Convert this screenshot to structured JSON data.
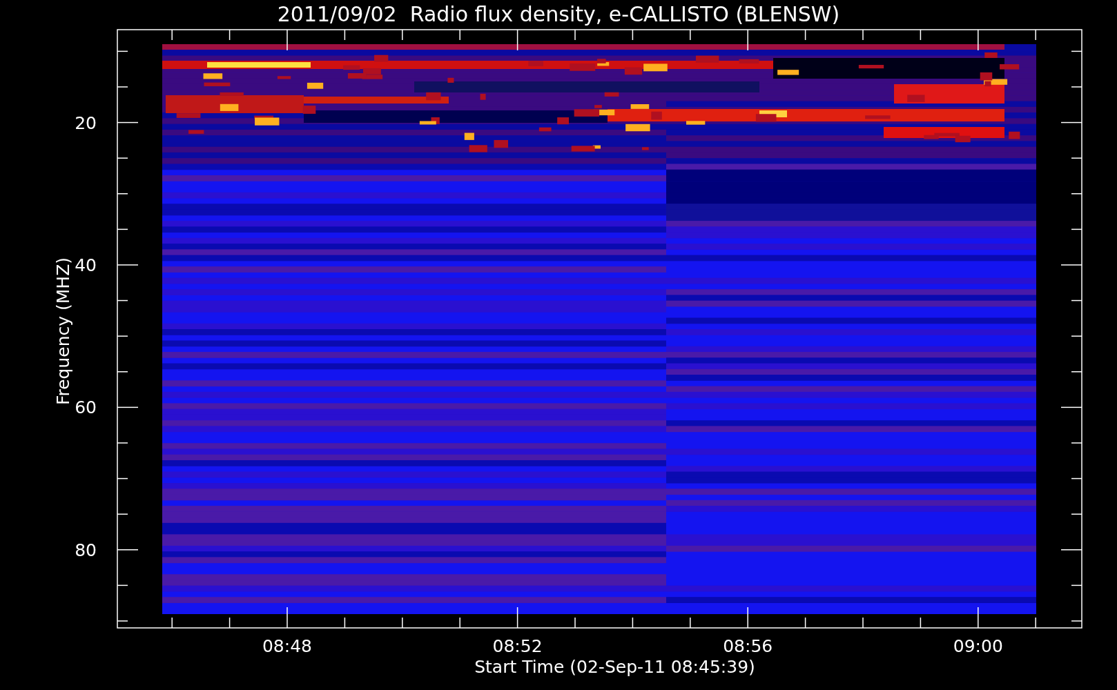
{
  "title": "2011/09/02  Radio flux density, e-CALLISTO (BLENSW)",
  "plot": {
    "ylabel": "Frequency (MHZ)",
    "xlabel": "Start Time (02-Sep-11 08:45:39)",
    "yticks": [
      {
        "label": "20"
      },
      {
        "label": "40"
      },
      {
        "label": "60"
      },
      {
        "label": "80"
      }
    ],
    "xticks": [
      {
        "label": "08:48"
      },
      {
        "label": "08:52"
      },
      {
        "label": "08:56"
      },
      {
        "label": "09:00"
      }
    ]
  }
}
